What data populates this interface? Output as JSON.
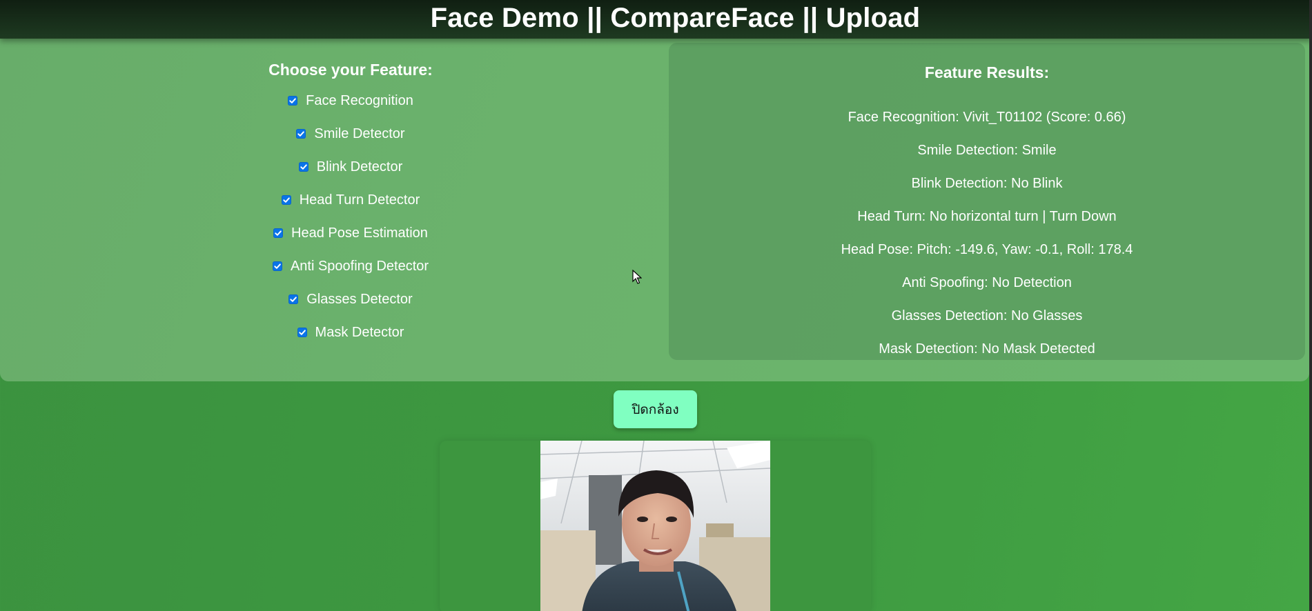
{
  "header": {
    "link_facedemo": "Face Demo",
    "sep1": "||",
    "link_compareface": "CompareFace",
    "sep2": "||",
    "link_upload": "Upload"
  },
  "features": {
    "title": "Choose your Feature:",
    "items": [
      {
        "label": "Face Recognition",
        "checked": true
      },
      {
        "label": "Smile Detector",
        "checked": true
      },
      {
        "label": "Blink Detector",
        "checked": true
      },
      {
        "label": "Head Turn Detector",
        "checked": true
      },
      {
        "label": "Head Pose Estimation",
        "checked": true
      },
      {
        "label": "Anti Spoofing Detector",
        "checked": true
      },
      {
        "label": "Glasses Detector",
        "checked": true
      },
      {
        "label": "Mask Detector",
        "checked": true
      }
    ]
  },
  "results": {
    "title": "Feature Results:",
    "items": [
      "Face Recognition: Vivit_T01102 (Score: 0.66)",
      "Smile Detection: Smile",
      "Blink Detection: No Blink",
      "Head Turn: No horizontal turn | Turn Down",
      "Head Pose: Pitch: -149.6, Yaw: -0.1, Roll: 178.4",
      "Anti Spoofing: No Detection",
      "Glasses Detection: No Glasses",
      "Mask Detection: No Mask Detected"
    ]
  },
  "camera": {
    "toggle_label": "ปิดกล้อง"
  },
  "colors": {
    "header_bg": "#132616",
    "panel_bg": "#6bb26c",
    "page_bg": "#3e9a41",
    "button_bg": "#80ffc1",
    "checkbox": "#0a74e8"
  }
}
